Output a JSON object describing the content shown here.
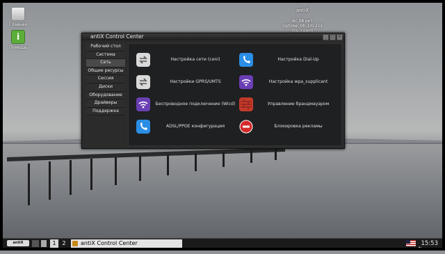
{
  "desktop": {
    "icons": [
      {
        "label": "Главная",
        "icon": "home-folder-icon"
      },
      {
        "label": "Помощь",
        "icon": "help-icon"
      }
    ]
  },
  "conky": {
    "title": "antiX",
    "date": "Вс 08 окт",
    "uptime": "Uptime: 0h 1m 21s",
    "wm": "ros-icewm"
  },
  "window": {
    "title": "antiX Control Center",
    "sidebar": [
      {
        "label": "Рабочий стол"
      },
      {
        "label": "Система"
      },
      {
        "label": "Сеть"
      },
      {
        "label": "Общие ресурсы"
      },
      {
        "label": "Сессия"
      },
      {
        "label": "Диски"
      },
      {
        "label": "Оборудование"
      },
      {
        "label": "Драйверы"
      },
      {
        "label": "Поддержка"
      }
    ],
    "active_section": "Сеть",
    "entries": [
      {
        "label": "Настройка сети (ceni)",
        "icon": "network-arrows-icon",
        "color": "#d9d9d9"
      },
      {
        "label": "Настройка Dial-Up",
        "icon": "phone-icon",
        "color": "#2b8ee6"
      },
      {
        "label": "Настройки GPRS/UMTS",
        "icon": "network-arrows-icon",
        "color": "#d9d9d9"
      },
      {
        "label": "Настройка wpa_supplicant",
        "icon": "wifi-icon",
        "color": "#6a3fb5"
      },
      {
        "label": "Беспроводное подключение (Wicd)",
        "icon": "wifi-icon",
        "color": "#6a3fb5"
      },
      {
        "label": "Управление брандмауэром",
        "icon": "firewall-icon",
        "color": "#c43b2b"
      },
      {
        "label": "ADSL/PPOE конфигурация",
        "icon": "phone-icon",
        "color": "#2b8ee6"
      },
      {
        "label": "Блокировка рекламы",
        "icon": "block-icon",
        "color": "#d42a2a"
      }
    ]
  },
  "taskbar": {
    "start_label": "antiX",
    "workspaces": [
      "1",
      "2"
    ],
    "active_workspace": "1",
    "task_label": "antiX Control Center",
    "clock": "15:53"
  }
}
